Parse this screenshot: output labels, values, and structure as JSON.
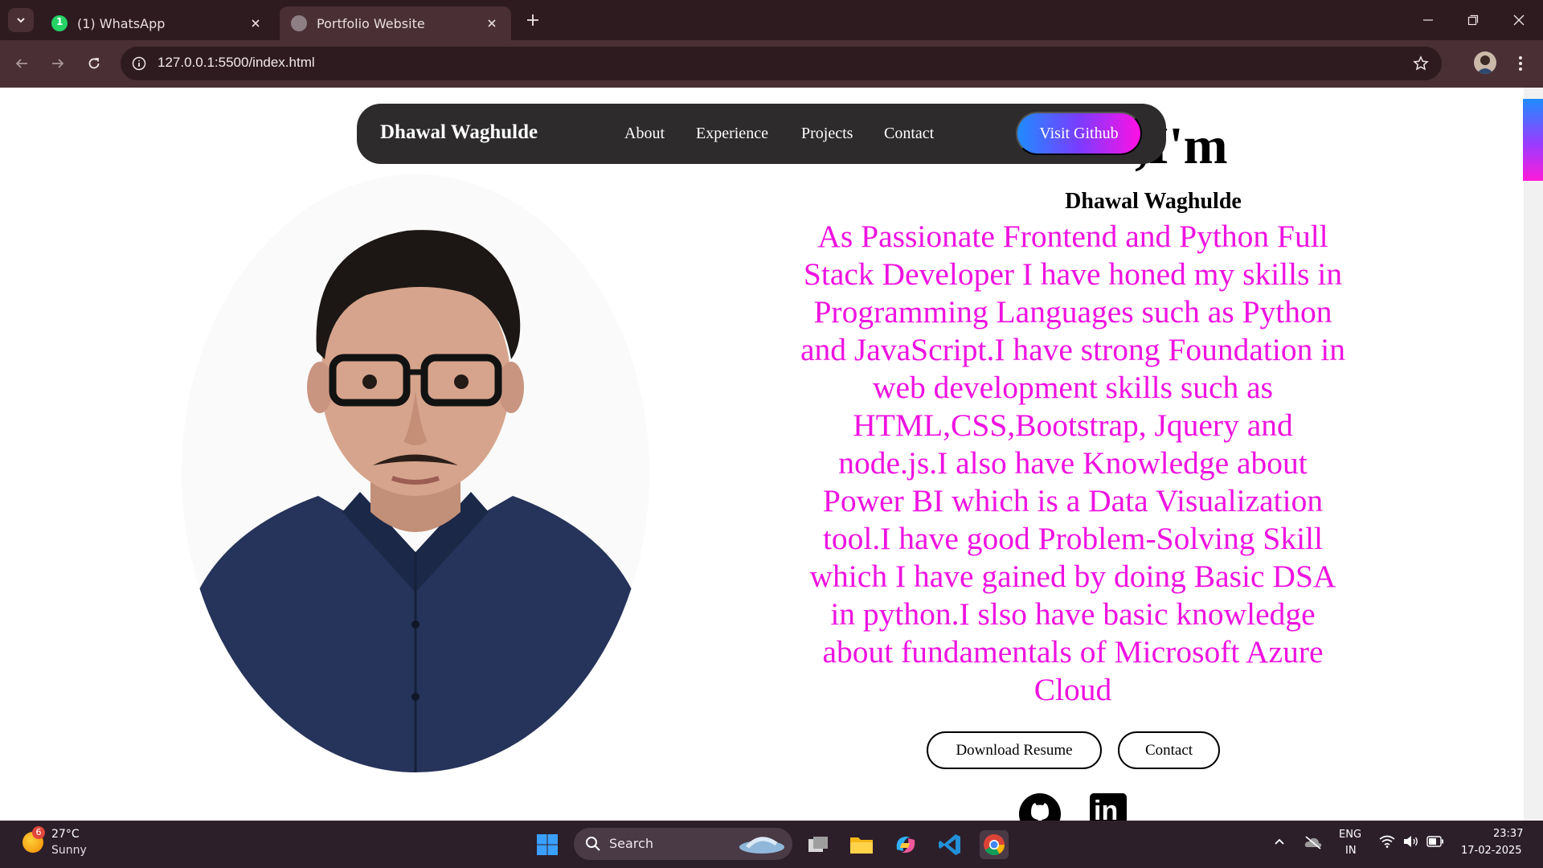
{
  "browser": {
    "tabs": [
      {
        "title": "(1) WhatsApp",
        "active": false,
        "favicon": "whatsapp-icon"
      },
      {
        "title": "Portfolio Website",
        "active": true,
        "favicon": "globe-icon"
      }
    ],
    "url": "127.0.0.1:5500/index.html"
  },
  "navbar": {
    "brand": "Dhawal Waghulde",
    "links": [
      "About",
      "Experience",
      "Projects",
      "Contact"
    ],
    "cta": "Visit Github"
  },
  "hero": {
    "heading": "Hi,I'm",
    "name": "Dhawal Waghulde",
    "description": "As Passionate Frontend and Python Full Stack Developer I have honed my skills in Programming Languages such as Python and JavaScript.I have strong Foundation in web development skills such as HTML,CSS,Bootstrap, Jquery and node.js.I also have Knowledge about Power BI which is a Data Visualization tool.I have good Problem-Solving Skill which I have gained by doing Basic DSA in python.I slso have basic knowledge about fundamentals of Microsoft Azure Cloud",
    "buttons": {
      "resume": "Download Resume",
      "contact": "Contact"
    },
    "social": [
      "github-icon",
      "linkedin-icon"
    ],
    "linkedin_glyph": "in"
  },
  "taskbar": {
    "weather": {
      "temp": "27°C",
      "condition": "Sunny",
      "badge": "6"
    },
    "search_label": "Search",
    "language": {
      "line1": "ENG",
      "line2": "IN"
    },
    "time": "23:37",
    "date": "17-02-2025"
  },
  "colors": {
    "accent_text": "#ee12e0",
    "nav_bg": "#2d2b2b",
    "cta_gradient": [
      "#1f8cff",
      "#ff10e3"
    ],
    "chrome_bg": "#2e1b20"
  }
}
